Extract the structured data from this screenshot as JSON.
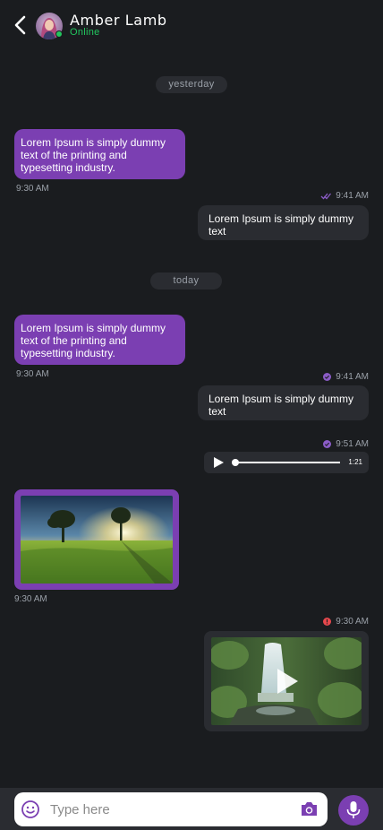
{
  "header": {
    "name": "Amber Lamb",
    "status": "Online"
  },
  "colors": {
    "background": "#1a1c1f",
    "incoming_bubble": "#7b3fb2",
    "outgoing_bubble": "#2a2c31",
    "online": "#22c55e",
    "error": "#e5484d",
    "accent": "#7b3fb2"
  },
  "icons": [
    "back-arrow-icon",
    "double-check-icon",
    "check-circle-icon",
    "error-icon",
    "play-icon",
    "emoji-icon",
    "camera-icon",
    "mic-icon"
  ],
  "messages": {
    "day1": "yesterday",
    "m1": {
      "text": "Lorem Ipsum is simply dummy text of the printing and typesetting industry.",
      "time": "9:30 AM"
    },
    "m2": {
      "text": "Lorem Ipsum is simply dummy text",
      "time": "9:41 AM",
      "status": "read"
    },
    "day2": "today",
    "m3": {
      "text": "Lorem Ipsum is simply dummy text of the printing and typesetting industry.",
      "time": "9:30 AM"
    },
    "m4": {
      "text": "Lorem Ipsum is simply dummy text",
      "time": "9:41 AM",
      "status": "delivered"
    },
    "m5": {
      "type": "audio",
      "time": "9:51 AM",
      "duration": "1:21",
      "progress": 0.0,
      "status": "delivered"
    },
    "m6": {
      "type": "image",
      "time": "9:30 AM",
      "subject": "landscape sunset field"
    },
    "m7": {
      "type": "video",
      "time": "9:30 AM",
      "status": "failed",
      "subject": "waterfall forest"
    }
  },
  "composer": {
    "placeholder": "Type here"
  }
}
